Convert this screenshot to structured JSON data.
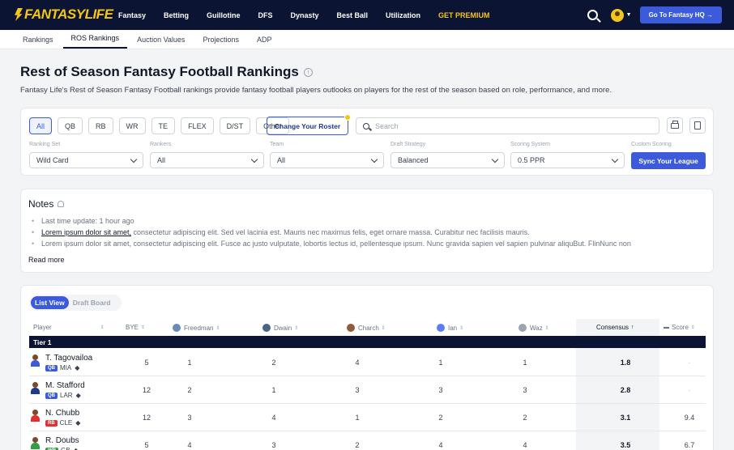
{
  "brand": {
    "logo_text": "FANTASYLIFE"
  },
  "nav": {
    "items": [
      "Fantasy",
      "Betting",
      "Guillotine",
      "DFS",
      "Dynasty",
      "Best Ball",
      "Utilization"
    ],
    "premium": "GET PREMIUM",
    "cta": "Go To Fantasy HQ",
    "cta_arrow": "→"
  },
  "subnav": {
    "tabs": [
      "Rankings",
      "ROS Rankings",
      "Auction Values",
      "Projections",
      "ADP"
    ],
    "active": "ROS Rankings"
  },
  "page": {
    "title": "Rest of Season Fantasy Football Rankings",
    "info_glyph": "i",
    "description": "Fantasy Life's Rest of Season Fantasy Football rankings provide fantasy football players outlooks on players for the rest of the season based on role, performance, and more."
  },
  "filters": {
    "positions": [
      "All",
      "QB",
      "RB",
      "WR",
      "TE",
      "FLEX",
      "D/ST",
      "Other"
    ],
    "active_position": "All",
    "change_roster": "Change Your Roster",
    "search_placeholder": "Search",
    "dropdowns": [
      {
        "label": "Ranking Set",
        "value": "Wild Card"
      },
      {
        "label": "Rankers",
        "value": "All"
      },
      {
        "label": "Team",
        "value": "All"
      },
      {
        "label": "Draft Strategy",
        "value": "Balanced"
      },
      {
        "label": "Scoring System",
        "value": "0.5 PPR"
      }
    ],
    "custom_scoring_label": "Custom Scoring",
    "sync_button": "Sync Your League"
  },
  "notes": {
    "title": "Notes",
    "last_update": "Last time update: 1 hour ago",
    "line2_link": "Lorem ipsum dolor sit amet,",
    "line2_rest": " consectetur adipiscing elit. Sed vel lacinia est. Mauris nec maximus felis, eget ornare massa. Curabitur nec facilisis mauris.",
    "line3": "Lorem ipsum dolor sit amet, consectetur adipiscing elit. Fusce ac justo vulputate, lobortis lectus id, pellentesque ipsum. Nunc gravida sapien vel sapien pulvinar aliquBut.  FlinNunc non",
    "read_more": "Read more"
  },
  "table": {
    "views": [
      "List View",
      "Draft Board"
    ],
    "active_view": "List View",
    "headers": {
      "player": "Player",
      "bye": "BYE",
      "rankers": [
        "Freedman",
        "Dwain",
        "Charch",
        "Ian",
        "Waz"
      ],
      "consensus": "Consensus",
      "score": "Score"
    },
    "sort_glyph": "⇕",
    "sort_up_glyph": "↑",
    "tier_label": "Tier 1",
    "rows": [
      {
        "name": "T. Tagovailoa",
        "pos": "QB",
        "team": "MIA",
        "bye": "5",
        "ranks": [
          "1",
          "2",
          "4",
          "1",
          "1"
        ],
        "consensus": "1.8",
        "score": "-"
      },
      {
        "name": "M. Stafford",
        "pos": "QB",
        "team": "LAR",
        "bye": "12",
        "ranks": [
          "2",
          "1",
          "3",
          "3",
          "3"
        ],
        "consensus": "2.8",
        "score": "-"
      },
      {
        "name": "N. Chubb",
        "pos": "RB",
        "team": "CLE",
        "bye": "12",
        "ranks": [
          "3",
          "4",
          "1",
          "2",
          "2"
        ],
        "consensus": "3.1",
        "score": "9.4"
      },
      {
        "name": "R. Doubs",
        "pos": "WR",
        "team": "GB",
        "bye": "5",
        "ranks": [
          "4",
          "3",
          "2",
          "4",
          "4"
        ],
        "consensus": "3.5",
        "score": "6.7"
      }
    ]
  },
  "colors": {
    "navy": "#0b1533",
    "accent": "#3b5bdb",
    "gold": "#f5c518",
    "qb": "#3b5bdb",
    "rb": "#e03131",
    "wr": "#2f9e44"
  }
}
